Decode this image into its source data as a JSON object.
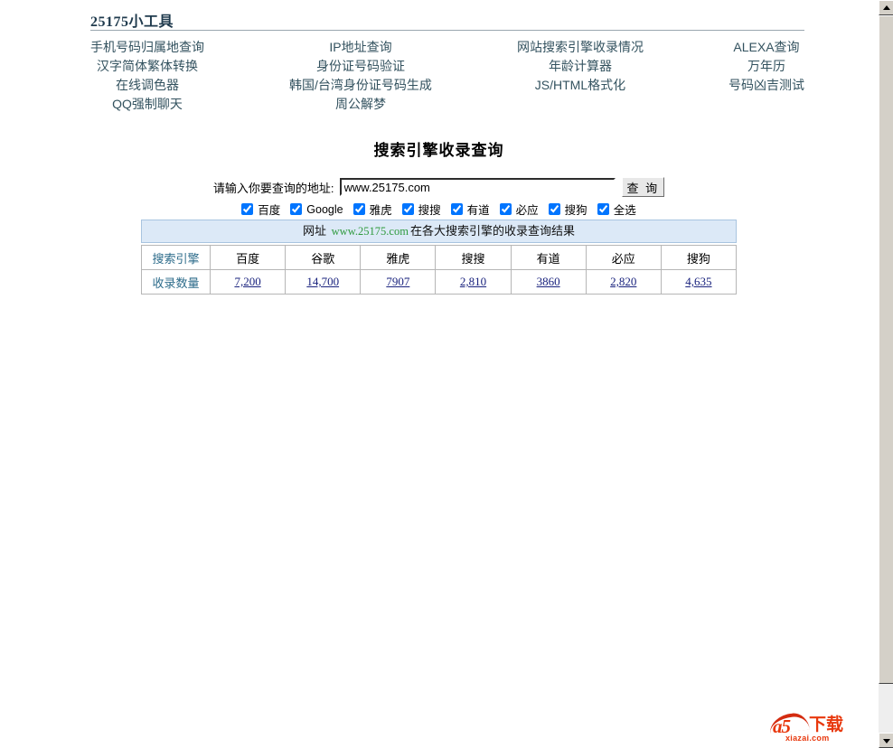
{
  "site": {
    "title": "25175小工具"
  },
  "nav": {
    "columns": [
      {
        "links": [
          "手机号码归属地查询",
          "汉字简体繁体转换",
          "在线调色器",
          "QQ强制聊天"
        ]
      },
      {
        "links": [
          "IP地址查询",
          "身份证号码验证",
          "韩国/台湾身份证号码生成",
          "周公解梦"
        ]
      },
      {
        "links": [
          "网站搜索引擎收录情况",
          "年龄计算器",
          "JS/HTML格式化"
        ]
      },
      {
        "links": [
          "ALEXA查询",
          "万年历",
          "号码凶吉测试"
        ]
      }
    ]
  },
  "page": {
    "heading": "搜索引擎收录查询"
  },
  "form": {
    "label": "请输入你要查询的地址:",
    "input_value": "www.25175.com",
    "input_placeholder": "",
    "submit_label": "查 询",
    "engines": [
      {
        "label": "百度",
        "checked": true
      },
      {
        "label": "Google",
        "checked": true
      },
      {
        "label": "雅虎",
        "checked": true
      },
      {
        "label": "搜搜",
        "checked": true
      },
      {
        "label": "有道",
        "checked": true
      },
      {
        "label": "必应",
        "checked": true
      },
      {
        "label": "搜狗",
        "checked": true
      },
      {
        "label": "全选",
        "checked": true
      }
    ]
  },
  "result": {
    "banner_prefix": "网址 ",
    "banner_url": "www.25175.com",
    "banner_suffix": "在各大搜索引擎的收录查询结果",
    "header_row_label": "搜索引擎",
    "data_row_label": "收录数量",
    "engines": [
      "百度",
      "谷歌",
      "雅虎",
      "搜搜",
      "有道",
      "必应",
      "搜狗"
    ],
    "counts": [
      "7,200",
      "14,700",
      "7907",
      "2,810",
      "3860",
      "2,820",
      "4,635"
    ]
  },
  "watermark": {
    "mark": "a5",
    "cn": "下载",
    "domain": "xiazai.com"
  },
  "colors": {
    "nav_link": "#33525f",
    "banner_bg": "#dce9f7",
    "banner_url": "#2f9a3e",
    "row_label": "#2c6b8a",
    "link": "#1a237e",
    "watermark": "#e8380d"
  },
  "scrollbar": {
    "up_arrow": "scroll-up-icon",
    "down_arrow": "scroll-down-icon"
  }
}
